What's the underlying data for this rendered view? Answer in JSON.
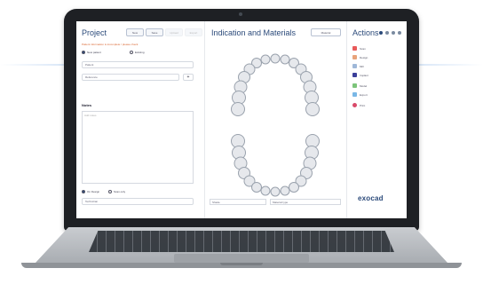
{
  "project": {
    "title": "Project",
    "btn1": "New",
    "btn2": "Save",
    "btn3": "Upload",
    "btn4": "Export",
    "warning": "Patient information is incomplete / please check",
    "radio1": "New patient",
    "radio2": "Existing",
    "field_patient": "Patient",
    "field_ref": "Reference",
    "notes_label": "Notes",
    "notes_placeholder": "Add notes",
    "bottom_radio1": "On Design",
    "bottom_radio2": "Scan only",
    "bottom_field": "Technician"
  },
  "indication": {
    "title": "Indication and Materials",
    "dropdown": "Material",
    "field1": "Shade",
    "field2": "Material type"
  },
  "actions": {
    "title": "Actions",
    "items": [
      {
        "label": "Scan",
        "color": "#e85a5a"
      },
      {
        "label": "Design",
        "color": "#e8a37a"
      },
      {
        "label": "Mill",
        "color": "#9fb8d8"
      },
      {
        "label": "Implant",
        "color": "#3b3f9a"
      },
      {
        "label": "Model",
        "color": "#7cc47a"
      },
      {
        "label": "Export",
        "color": "#7ab8e6"
      },
      {
        "label": "Print",
        "color": "#d94a6a"
      }
    ],
    "logo": "exocad"
  }
}
